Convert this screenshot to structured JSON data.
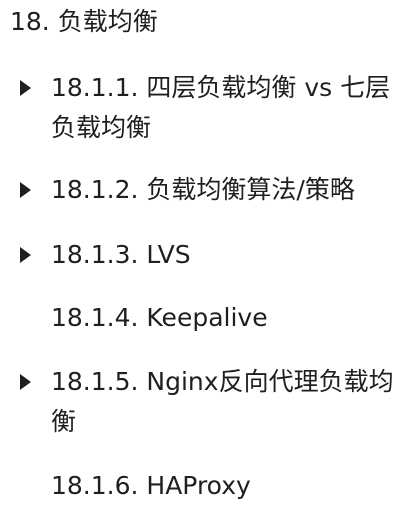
{
  "section": {
    "title": "18. 负载均衡"
  },
  "items": [
    {
      "label": "18.1.1. 四层负载均衡 vs 七层负载均衡",
      "expandable": true
    },
    {
      "label": "18.1.2. 负载均衡算法/策略",
      "expandable": true
    },
    {
      "label": "18.1.3. LVS",
      "expandable": true
    },
    {
      "label": "18.1.4. Keepalive",
      "expandable": false
    },
    {
      "label": "18.1.5. Nginx反向代理负载均衡",
      "expandable": true
    },
    {
      "label": "18.1.6. HAProxy",
      "expandable": false
    }
  ],
  "icons": {
    "expand": "caret-right-icon"
  },
  "colors": {
    "text": "#1f1f1f",
    "background": "#ffffff"
  }
}
